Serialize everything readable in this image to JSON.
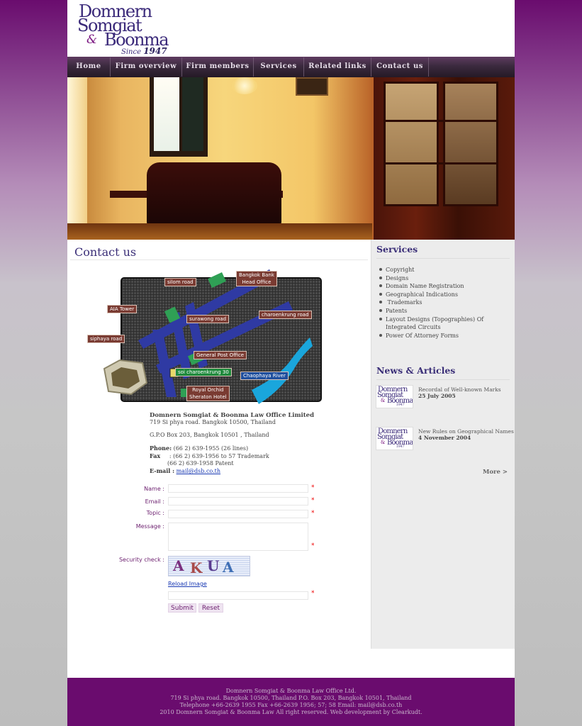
{
  "logo": {
    "line1": "Domnern",
    "line2": "Somgiat",
    "amp": "&",
    "line3": "Boonma",
    "since": "Since",
    "year": "1947"
  },
  "nav": {
    "items": [
      {
        "label": "Home"
      },
      {
        "label": "Firm overview"
      },
      {
        "label": "Firm members"
      },
      {
        "label": "Services"
      },
      {
        "label": "Related links"
      },
      {
        "label": "Contact us"
      }
    ]
  },
  "main": {
    "title": "Contact us",
    "map": {
      "labels": {
        "silom": "silom road",
        "bangkok_bank_1": "Bangkok Bank",
        "bangkok_bank_2": "Head Office",
        "aia": "AIA Tower",
        "charoenkrung": "charoenkrung road",
        "surawong": "surawong road",
        "siphaya": "siphaya road",
        "gpo": "General Post Office",
        "soi": "soi charoenkrung 30",
        "chaophaya": "Chaophaya River",
        "royal_orchid_1": "Royal Orchid",
        "royal_orchid_2": "Sheraton Hotel"
      }
    },
    "address": {
      "firm": "Domnern  Somgiat & Boonma Law Office Limited",
      "street": "719 Si phya road. Bangkok 10500, Thailand",
      "pobox": "G.P.O Box 203, Bangkok 10501 , Thailand",
      "phone_label": "Phone:",
      "phone": " (66 2) 639-1955 (26 lines)",
      "fax_label": "Fax",
      "fax1": "     : (66 2) 639-1956 to 57 Trademark",
      "fax2": "(66 2) 639-1958 Patent",
      "email_label": "E-mail :",
      "email": "mail@dsb.co.th"
    },
    "form": {
      "name_label": "Name :",
      "email_label": "Email :",
      "topic_label": "Topic :",
      "message_label": "Message :",
      "security_label": "Security check :",
      "required_mark": "*",
      "captcha_text": [
        "A",
        "K",
        "U",
        "A"
      ],
      "reload_label": "Reload Image",
      "submit_label": "Submit",
      "reset_label": "Reset"
    }
  },
  "sidebar": {
    "services_title": "Services",
    "services": [
      "Copyright",
      "Designs",
      "Domain Name Registration",
      "Geographical Indications",
      " Trademarks",
      "Patents",
      "Layout Designs (Topographies) Of Integrated Circuits",
      "Power Of Attorney Forms"
    ],
    "news_title": "News & Articles",
    "news": [
      {
        "title": "Recordal of Well-known Marks",
        "date": "25 July 2005"
      },
      {
        "title": "New Rules on Geographical Names",
        "date": "4 November 2004"
      }
    ],
    "more_label": "More >"
  },
  "footer": {
    "line1": "Domnern Somgiat & Boonma Law Office Ltd.",
    "line2": "719 Si phya road. Bangkok 10500, Thailand P.O. Box 203, Bangkok 10501, Thailand",
    "line3": "Telephone +66-2639 1955 Fax +66-2639 1956; 57; 58 Email: mail@dsb.co.th",
    "line4": "2010 Domnern Somgiat & Boonma Law All right reserved. Web development by Clearkudt."
  },
  "colors": {
    "brand_purple": "#6a0c6e",
    "heading_blue": "#3b2f78",
    "link_blue": "#1a3ab3",
    "required_red": "#ee0000"
  }
}
